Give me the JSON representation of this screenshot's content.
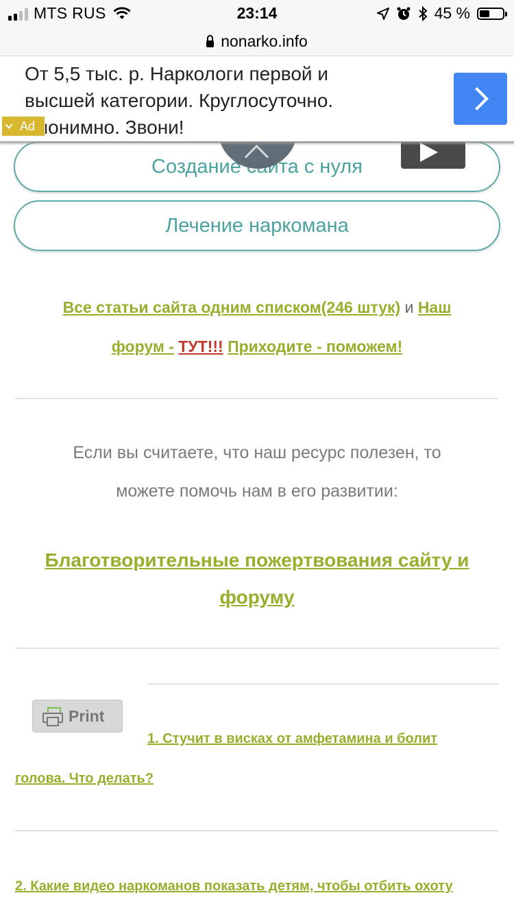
{
  "status_bar": {
    "carrier": "MTS RUS",
    "time": "23:14",
    "battery": "45 %",
    "battery_level": 0.45
  },
  "browser": {
    "url": "nonarko.info"
  },
  "ad": {
    "text_line1": "От 5,5 тыс. р. Наркологи первой и",
    "text_line2": "высшей категории. Круглосуточно.",
    "text_line3": "Анонимно. Звони!",
    "badge": "Ad"
  },
  "menu": {
    "pill1": "Создание сайта с нуля",
    "pill2": "Лечение наркомана"
  },
  "links": {
    "all_articles": "Все статьи сайта одним списком(246 штук)",
    "and": "и",
    "forum_part1": "Наш",
    "forum_part2": "форум -",
    "here": "ТУТ!!!",
    "help": "Приходите - поможем!"
  },
  "support": {
    "line1": "Если вы считаете, что наш ресурс полезен, то",
    "line2": "можете помочь нам в его развитии:",
    "donate_line1": "Благотворительные пожертвования сайту и",
    "donate_line2": "форуму"
  },
  "print": {
    "label": "Print"
  },
  "articles": {
    "a1_part1": "1. Стучит в висках от амфетамина и болит",
    "a1_part2": "голова. Что делать?",
    "a2": "2. Какие видео наркоманов показать детям, чтобы отбить охоту"
  },
  "icons": [
    "signal-icon",
    "wifi-icon",
    "location-icon",
    "alarm-icon",
    "bluetooth-icon",
    "battery-icon",
    "lock-icon",
    "chevron-right-icon",
    "chevron-up-icon",
    "play-icon",
    "printer-icon"
  ]
}
